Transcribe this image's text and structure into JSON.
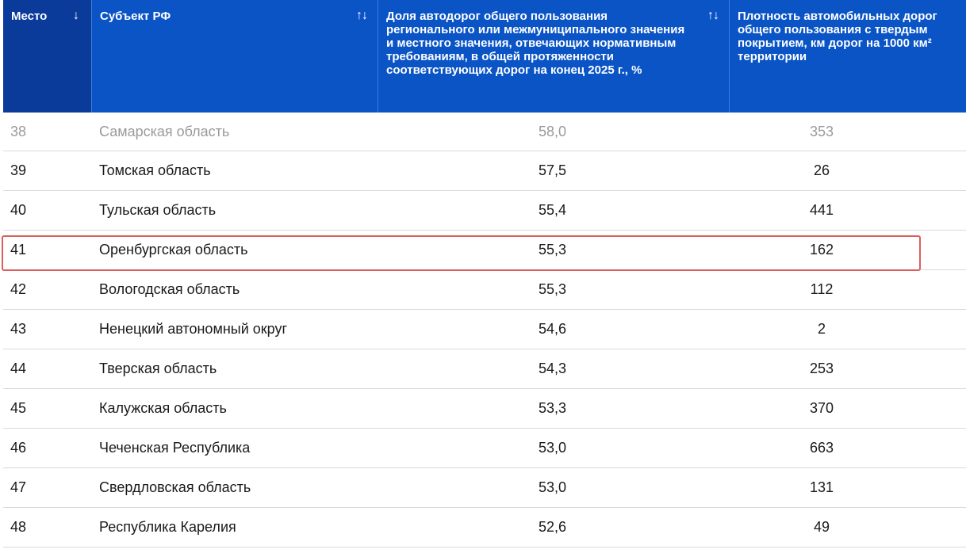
{
  "table": {
    "headers": {
      "rank": "Место",
      "rank_sort": "↓",
      "region": "Субъект РФ",
      "region_sort": "↑↓",
      "share": "Доля автодорог общего пользования регионального или межмуниципального значения и местного значения, отвечающих нормативным требованиям, в общей протяженности соответствующих дорог на конец 2025 г., %",
      "share_sort": "↑↓",
      "density": "Плотность автомобильных дорог общего пользования с твердым покрытием, км дорог на 1000 км² территории"
    },
    "rows": [
      {
        "rank": "38",
        "region": "Самарская область",
        "share": "58,0",
        "density": "353"
      },
      {
        "rank": "39",
        "region": "Томская область",
        "share": "57,5",
        "density": "26"
      },
      {
        "rank": "40",
        "region": "Тульская область",
        "share": "55,4",
        "density": "441"
      },
      {
        "rank": "41",
        "region": "Оренбургская область",
        "share": "55,3",
        "density": "162"
      },
      {
        "rank": "42",
        "region": "Вологодская область",
        "share": "55,3",
        "density": "112"
      },
      {
        "rank": "43",
        "region": "Ненецкий автономный округ",
        "share": "54,6",
        "density": "2"
      },
      {
        "rank": "44",
        "region": "Тверская область",
        "share": "54,3",
        "density": "253"
      },
      {
        "rank": "45",
        "region": "Калужская область",
        "share": "53,3",
        "density": "370"
      },
      {
        "rank": "46",
        "region": "Чеченская Республика",
        "share": "53,0",
        "density": "663"
      },
      {
        "rank": "47",
        "region": "Свердловская область",
        "share": "53,0",
        "density": "131"
      },
      {
        "rank": "48",
        "region": "Республика Карелия",
        "share": "52,6",
        "density": "49"
      }
    ],
    "highlighted_row": "41"
  },
  "colors": {
    "header_bg": "#0a54c6",
    "header_rank_bg": "#0a3a9a",
    "highlight_border": "#d9605d"
  }
}
